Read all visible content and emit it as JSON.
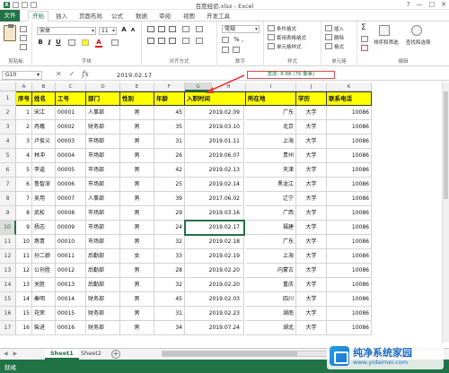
{
  "window": {
    "title": "百度经验.xlsx - Excel",
    "controls": [
      "?",
      "—",
      "□",
      "✕"
    ]
  },
  "ribbon_tabs": [
    {
      "label": "文件",
      "id": "file"
    },
    {
      "label": "开始",
      "id": "home"
    },
    {
      "label": "插入",
      "id": "insert"
    },
    {
      "label": "页面布局",
      "id": "layout"
    },
    {
      "label": "公式",
      "id": "formulas"
    },
    {
      "label": "数据",
      "id": "data"
    },
    {
      "label": "审阅",
      "id": "review"
    },
    {
      "label": "视图",
      "id": "view"
    },
    {
      "label": "开发工具",
      "id": "developer"
    }
  ],
  "ribbon": {
    "clipboard_label": "剪贴板",
    "font_label": "字体",
    "font_name": "宋体",
    "font_size": "11",
    "align_label": "对齐方式",
    "number_label": "数字",
    "number_format": "常规",
    "number_symbols": [
      "%",
      ","
    ],
    "styles_label": "样式",
    "style_items": [
      "条件格式",
      "套用表格格式",
      "单元格样式"
    ],
    "cells_label": "单元格",
    "cell_items": [
      "插入",
      "删除",
      "格式"
    ],
    "edit_label": "编辑",
    "edit_items": [
      "排序和筛选",
      "查找和选择"
    ]
  },
  "formula_bar": {
    "name_box": "G10",
    "value": "2019.02.17",
    "cancel": "✕",
    "enter": "✓",
    "fx": "fx"
  },
  "tooltip": "宽度: 8.88 (76 像素)",
  "columns": [
    "A",
    "B",
    "C",
    "D",
    "E",
    "F",
    "G",
    "H",
    "I",
    "J",
    "K"
  ],
  "selected_column": "G",
  "selected_row": "10",
  "table": {
    "headers": [
      "序号",
      "姓名",
      "工号",
      "部门",
      "性别",
      "年龄",
      "入职时间",
      "",
      "所在地",
      "学历",
      "联系电话"
    ],
    "rows": [
      [
        "1",
        "宋江",
        "00001",
        "人事部",
        "男",
        "45",
        "2019.02.09",
        "",
        "广东",
        "大学",
        "10086"
      ],
      [
        "2",
        "冉羲",
        "00002",
        "财务部",
        "男",
        "35",
        "2019.03.10",
        "",
        "北京",
        "大学",
        "10086"
      ],
      [
        "3",
        "卢俊义",
        "00003",
        "市场部",
        "男",
        "31",
        "2019.01.11",
        "",
        "上海",
        "大学",
        "10086"
      ],
      [
        "4",
        "林冲",
        "00004",
        "市场部",
        "男",
        "26",
        "2019.06.07",
        "",
        "贵州",
        "大学",
        "10086"
      ],
      [
        "5",
        "李逵",
        "00005",
        "市场部",
        "男",
        "42",
        "2019.02.13",
        "",
        "天津",
        "大学",
        "10086"
      ],
      [
        "6",
        "鲁智深",
        "00006",
        "市场部",
        "男",
        "25",
        "2019.02.14",
        "",
        "黑龙江",
        "大学",
        "10086"
      ],
      [
        "7",
        "吴用",
        "00007",
        "人事部",
        "男",
        "39",
        "2017.06.02",
        "",
        "辽宁",
        "大学",
        "10086"
      ],
      [
        "8",
        "武松",
        "00008",
        "市场部",
        "男",
        "29",
        "2019.03.16",
        "",
        "广西",
        "大学",
        "10086"
      ],
      [
        "9",
        "杨志",
        "00009",
        "市场部",
        "男",
        "24",
        "2019.02.17",
        "",
        "福建",
        "大学",
        "10086"
      ],
      [
        "10",
        "燕青",
        "00010",
        "市场部",
        "男",
        "32",
        "2019.02.18",
        "",
        "广东",
        "大学",
        "10086"
      ],
      [
        "11",
        "孙二娘",
        "00011",
        "后勤部",
        "女",
        "33",
        "2019.02.19",
        "",
        "上海",
        "大学",
        "10086"
      ],
      [
        "12",
        "公孙胜",
        "00012",
        "后勤部",
        "男",
        "28",
        "2019.02.20",
        "",
        "内蒙古",
        "大学",
        "10086"
      ],
      [
        "13",
        "关胜",
        "00013",
        "后勤部",
        "男",
        "32",
        "2019.02.20",
        "",
        "重庆",
        "大学",
        "10086"
      ],
      [
        "14",
        "秦明",
        "00014",
        "财务部",
        "男",
        "45",
        "2019.02.03",
        "",
        "四川",
        "大学",
        "10086"
      ],
      [
        "15",
        "花荣",
        "00015",
        "财务部",
        "男",
        "31",
        "2019.02.23",
        "",
        "湖南",
        "大学",
        "10086"
      ],
      [
        "16",
        "柴进",
        "00016",
        "财务部",
        "男",
        "34",
        "2019.07.24",
        "",
        "湖北",
        "大学",
        "10086"
      ]
    ]
  },
  "sheet_tabs": [
    {
      "label": "Sheet1",
      "active": true
    },
    {
      "label": "Sheet2",
      "active": false
    }
  ],
  "status": "就绪",
  "watermark": {
    "title": "纯净系统家园",
    "url": "www.yidaimei.com"
  },
  "colors": {
    "excel_green": "#217346",
    "header_fill": "#ffff00",
    "tooltip_border": "#e24a4a"
  }
}
